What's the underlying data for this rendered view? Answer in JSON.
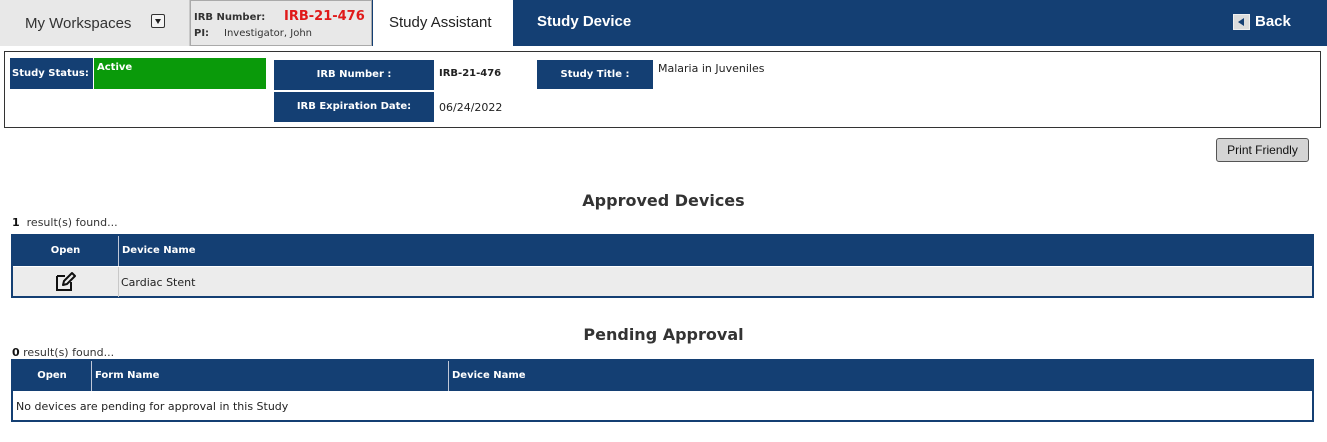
{
  "topnav": {
    "workspaces_label": "My Workspaces",
    "irb_label": "IRB Number:",
    "irb_value": "IRB-21-476",
    "pi_label": "PI:",
    "pi_value": "Investigator, John",
    "tab_study_assistant": "Study Assistant",
    "page_title": "Study Device",
    "back_label": "Back"
  },
  "info": {
    "status_label": "Study Status:",
    "status_value": "Active",
    "irb_number_label": "IRB Number :",
    "irb_number_value": "IRB-21-476",
    "expiration_label": "IRB Expiration Date:",
    "expiration_value": "06/24/2022",
    "study_title_label": "Study Title :",
    "study_title_value": "Malaria in Juveniles"
  },
  "print_button": "Print Friendly",
  "approved": {
    "title": "Approved Devices",
    "count": "1",
    "count_suffix": "result(s) found...",
    "columns": [
      "Open",
      "Device Name"
    ],
    "rows": [
      {
        "device_name": "Cardiac Stent"
      }
    ]
  },
  "pending": {
    "title": "Pending Approval",
    "count": "0",
    "count_suffix": "result(s) found...",
    "columns": [
      "Open",
      "Form Name",
      "Device Name"
    ],
    "empty_message": "No devices are pending for approval in this Study"
  },
  "colors": {
    "navy": "#143f73",
    "status_active": "#0a9a0a",
    "irb_red": "#e01a1a"
  },
  "icons": [
    "dropdown-caret-icon",
    "back-arrow-icon",
    "edit-icon"
  ]
}
